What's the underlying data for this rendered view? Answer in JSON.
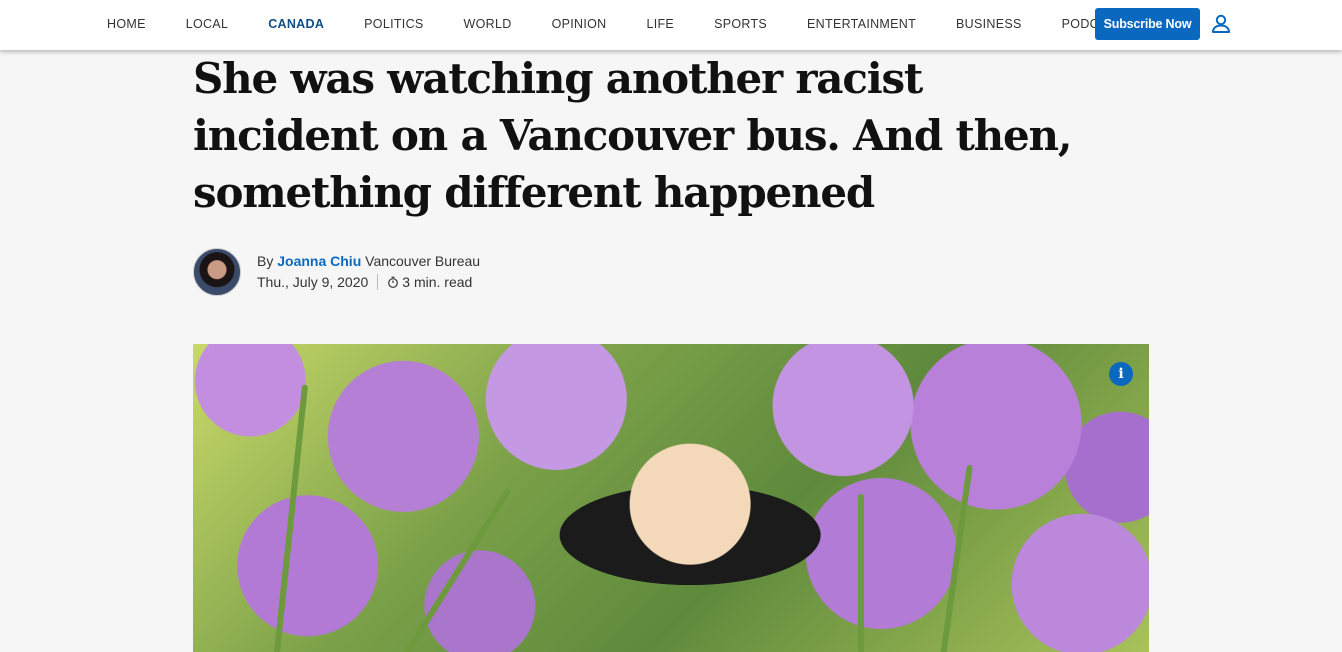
{
  "nav": {
    "items": [
      {
        "label": "HOME",
        "active": false
      },
      {
        "label": "LOCAL",
        "active": false
      },
      {
        "label": "CANADA",
        "active": true
      },
      {
        "label": "POLITICS",
        "active": false
      },
      {
        "label": "WORLD",
        "active": false
      },
      {
        "label": "OPINION",
        "active": false
      },
      {
        "label": "LIFE",
        "active": false
      },
      {
        "label": "SPORTS",
        "active": false
      },
      {
        "label": "ENTERTAINMENT",
        "active": false
      },
      {
        "label": "BUSINESS",
        "active": false
      },
      {
        "label": "PODCASTS",
        "active": false
      }
    ],
    "subscribe_label": "Subscribe Now",
    "user_icon": "user-icon"
  },
  "article": {
    "headline": "She was watching another racist incident on a Vancouver bus. And then, something different happened",
    "byline": {
      "prefix": "By",
      "author": "Joanna Chiu",
      "bureau": "Vancouver Bureau",
      "date": "Thu., July 9, 2020",
      "read_time": "3 min. read"
    },
    "hero": {
      "info_label": "i"
    }
  },
  "colors": {
    "accent": "#0a68bf",
    "active_nav": "#0f4e86",
    "background": "#f6f6f6"
  }
}
